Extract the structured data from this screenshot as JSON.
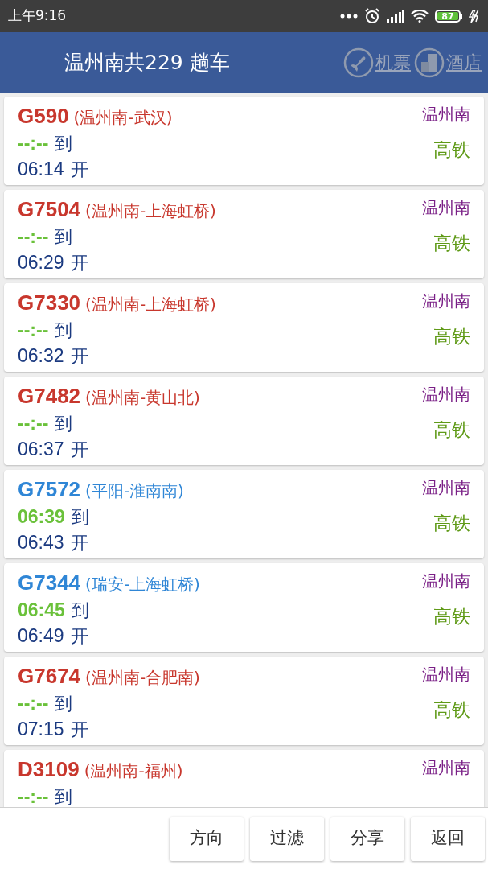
{
  "status_bar": {
    "time": "上午9:16",
    "battery": "87"
  },
  "header": {
    "title": "温州南共229 趟车",
    "links": [
      "机票",
      "酒店"
    ]
  },
  "trains": [
    {
      "code": "G590",
      "route": "(温州南-武汉)",
      "color": "#c8372d",
      "arrive": "--:--",
      "arrive_label": "到",
      "depart": "06:14",
      "depart_label": "开",
      "station": "温州南",
      "type": "高铁"
    },
    {
      "code": "G7504",
      "route": "(温州南-上海虹桥)",
      "color": "#c8372d",
      "arrive": "--:--",
      "arrive_label": "到",
      "depart": "06:29",
      "depart_label": "开",
      "station": "温州南",
      "type": "高铁"
    },
    {
      "code": "G7330",
      "route": "(温州南-上海虹桥)",
      "color": "#c8372d",
      "arrive": "--:--",
      "arrive_label": "到",
      "depart": "06:32",
      "depart_label": "开",
      "station": "温州南",
      "type": "高铁"
    },
    {
      "code": "G7482",
      "route": "(温州南-黄山北)",
      "color": "#c8372d",
      "arrive": "--:--",
      "arrive_label": "到",
      "depart": "06:37",
      "depart_label": "开",
      "station": "温州南",
      "type": "高铁"
    },
    {
      "code": "G7572",
      "route": "(平阳-淮南南)",
      "color": "#2f86d6",
      "arrive": "06:39",
      "arrive_label": "到",
      "depart": "06:43",
      "depart_label": "开",
      "station": "温州南",
      "type": "高铁"
    },
    {
      "code": "G7344",
      "route": "(瑞安-上海虹桥)",
      "color": "#2f86d6",
      "arrive": "06:45",
      "arrive_label": "到",
      "depart": "06:49",
      "depart_label": "开",
      "station": "温州南",
      "type": "高铁"
    },
    {
      "code": "G7674",
      "route": "(温州南-合肥南)",
      "color": "#c8372d",
      "arrive": "--:--",
      "arrive_label": "到",
      "depart": "07:15",
      "depart_label": "开",
      "station": "温州南",
      "type": "高铁"
    },
    {
      "code": "D3109",
      "route": "(温州南-福州)",
      "color": "#c8372d",
      "arrive": "--:--",
      "arrive_label": "到",
      "station": "温州南"
    }
  ],
  "buttons": [
    "方向",
    "过滤",
    "分享",
    "返回"
  ]
}
